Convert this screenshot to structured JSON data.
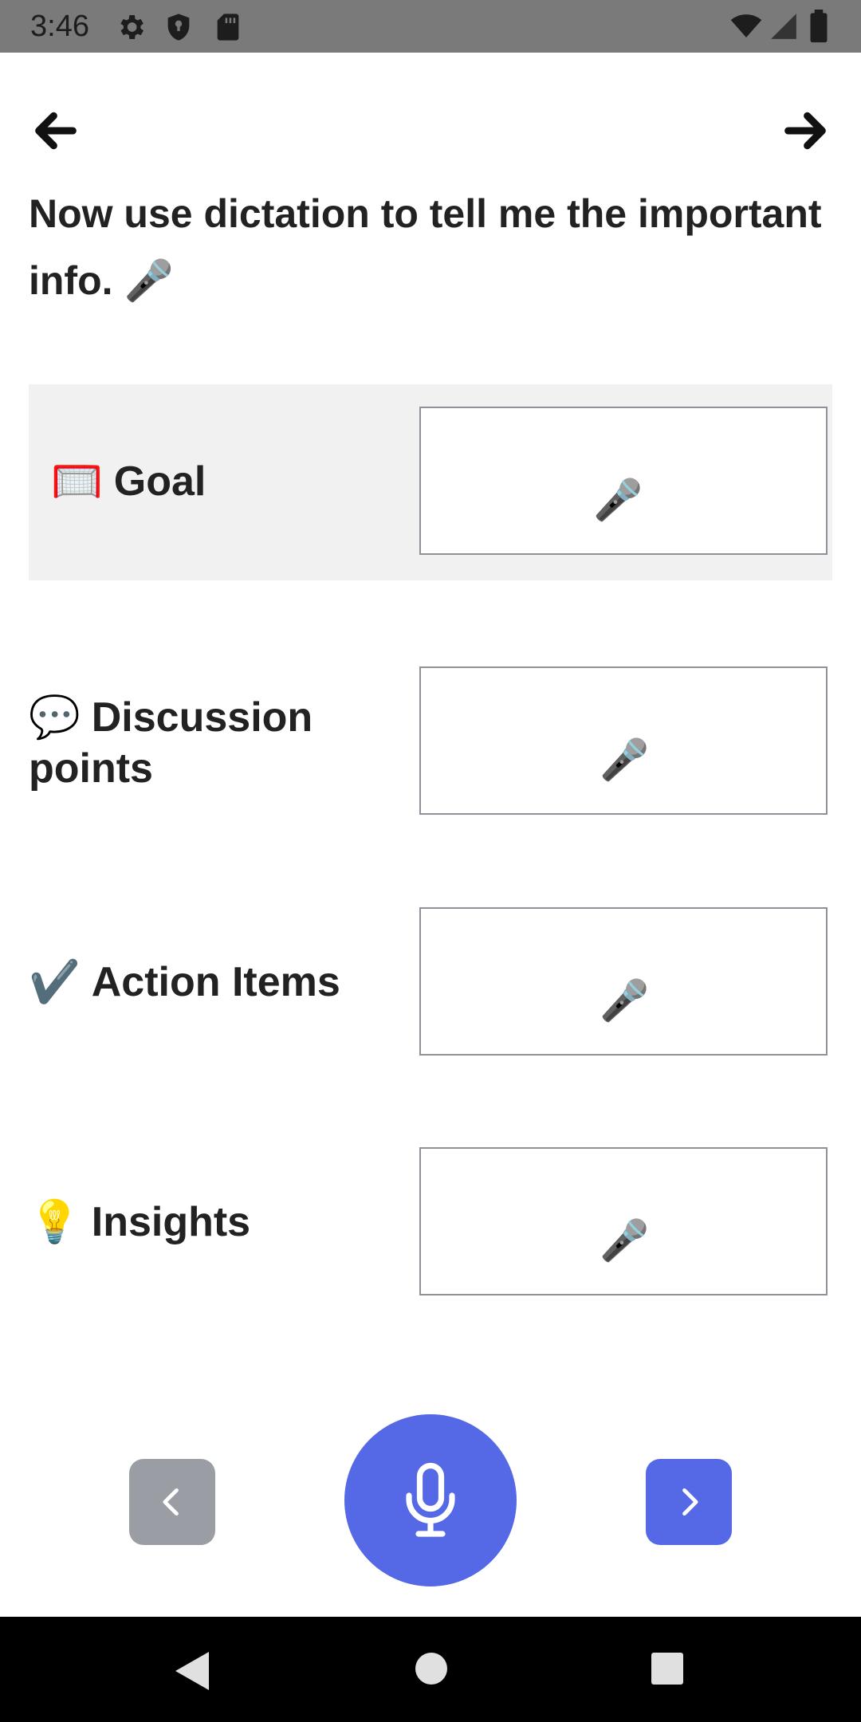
{
  "status_bar": {
    "time": "3:46",
    "left_icons": [
      "gear-icon",
      "shield-icon",
      "sd-card-icon"
    ],
    "right_icons": [
      "wifi-icon",
      "signal-icon",
      "battery-icon"
    ]
  },
  "nav": {
    "back_icon": "arrow-left-icon",
    "forward_icon": "arrow-right-icon"
  },
  "heading": {
    "text": "Now use dictation to tell me the important info.",
    "emoji": "🎤"
  },
  "rows": [
    {
      "emoji": "🥅",
      "label": "Goal",
      "value": "",
      "placeholder_icon": "🎤",
      "highlighted": true
    },
    {
      "emoji": "💬",
      "label": "Discussion points",
      "value": "",
      "placeholder_icon": "🎤",
      "highlighted": false
    },
    {
      "emoji": "✔️",
      "label": "Action Items",
      "value": "",
      "placeholder_icon": "🎤",
      "highlighted": false
    },
    {
      "emoji": "💡",
      "label": "Insights",
      "value": "",
      "placeholder_icon": "🎤",
      "highlighted": false
    }
  ],
  "controls": {
    "prev_icon": "chevron-left-icon",
    "mic_icon": "microphone-icon",
    "next_icon": "chevron-right-icon",
    "prev_color": "#9a9da3",
    "accent_color": "#5569e6"
  },
  "system_nav": [
    "back-triangle-icon",
    "home-circle-icon",
    "recents-square-icon"
  ]
}
